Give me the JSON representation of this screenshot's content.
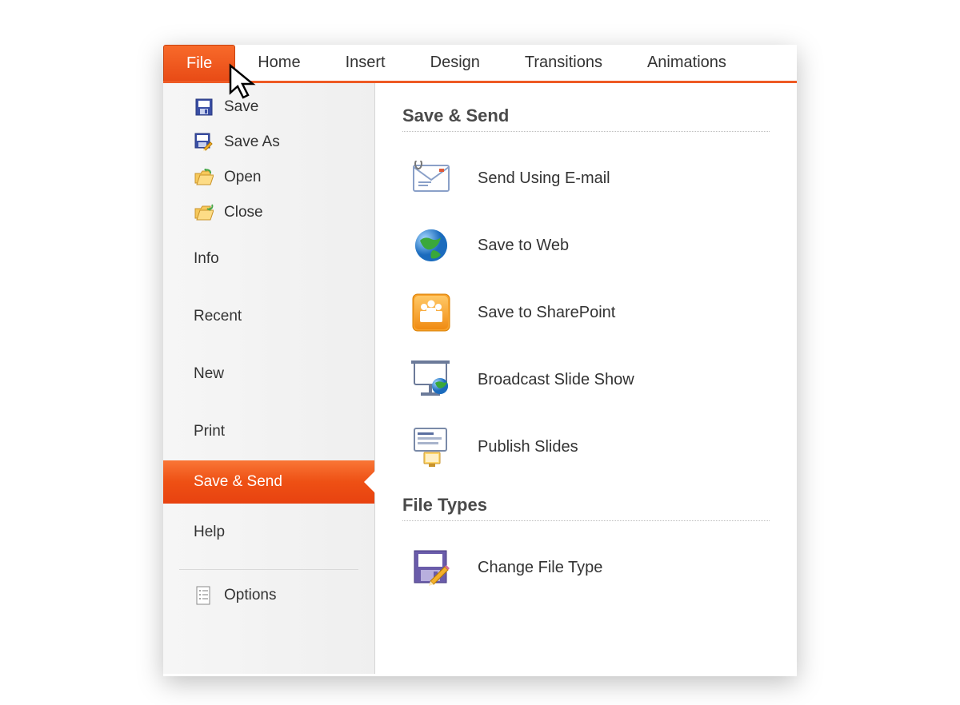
{
  "ribbon": {
    "tabs": [
      "File",
      "Home",
      "Insert",
      "Design",
      "Transitions",
      "Animations"
    ],
    "active": "File"
  },
  "sidebar": {
    "items": [
      {
        "label": "Save"
      },
      {
        "label": "Save As"
      },
      {
        "label": "Open"
      },
      {
        "label": "Close"
      },
      {
        "label": "Info"
      },
      {
        "label": "Recent"
      },
      {
        "label": "New"
      },
      {
        "label": "Print"
      },
      {
        "label": "Save & Send",
        "selected": true
      },
      {
        "label": "Help"
      },
      {
        "label": "Options"
      }
    ]
  },
  "main": {
    "section1": {
      "title": "Save & Send",
      "options": [
        {
          "label": "Send Using E-mail"
        },
        {
          "label": "Save to Web"
        },
        {
          "label": "Save to SharePoint"
        },
        {
          "label": "Broadcast Slide Show"
        },
        {
          "label": "Publish Slides"
        }
      ]
    },
    "section2": {
      "title": "File Types",
      "options": [
        {
          "label": "Change File Type"
        }
      ]
    }
  }
}
